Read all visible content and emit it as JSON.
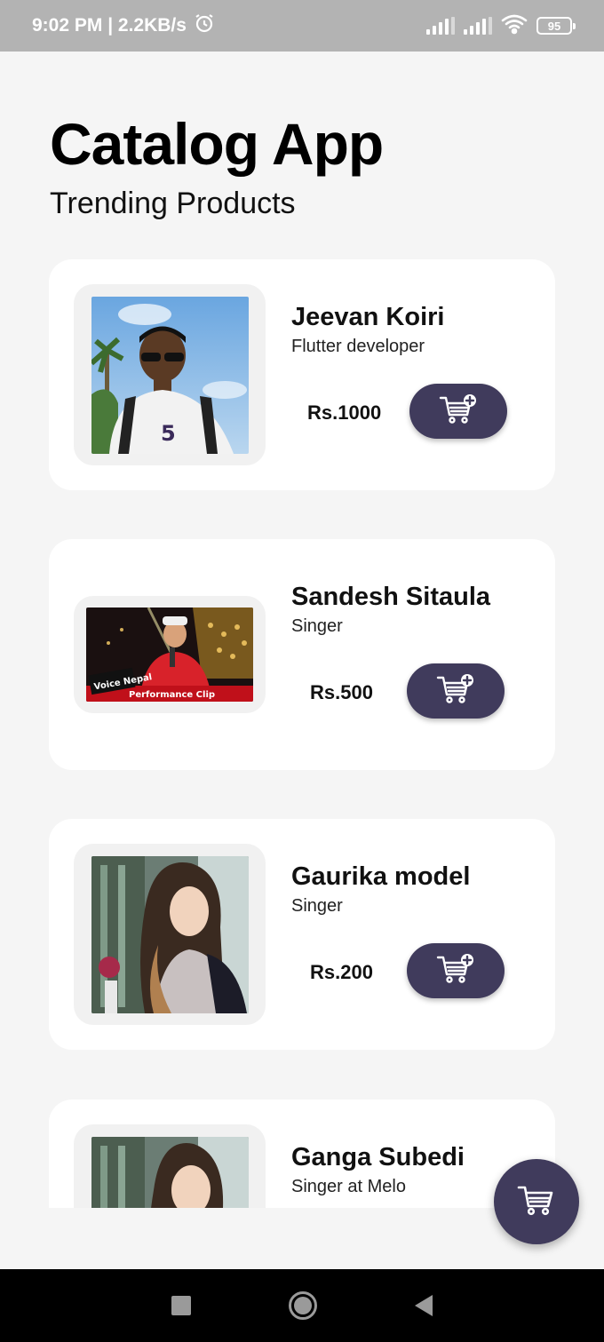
{
  "status_bar": {
    "time_speed": "9:02 PM | 2.2KB/s",
    "battery": "95"
  },
  "header": {
    "title": "Catalog App",
    "subtitle": "Trending Products"
  },
  "products": [
    {
      "name": "Jeevan Koiri",
      "desc": "Flutter developer",
      "price": "Rs.1000",
      "icon": "cart-add-icon"
    },
    {
      "name": "Sandesh Sitaula",
      "desc": "Singer",
      "price": "Rs.500",
      "icon": "cart-add-icon"
    },
    {
      "name": "Gaurika model",
      "desc": "Singer",
      "price": "Rs.200",
      "icon": "cart-add-icon"
    },
    {
      "name": "Ganga Subedi",
      "desc": "Singer at Melo"
    }
  ],
  "thumb_captions": {
    "voice_logo": "Voice Nepal",
    "performance_clip": "Performance Clip"
  },
  "colors": {
    "accent": "#403b5c",
    "background": "#f5f5f5",
    "card": "#ffffff",
    "status_bar": "#b3b3b3"
  }
}
